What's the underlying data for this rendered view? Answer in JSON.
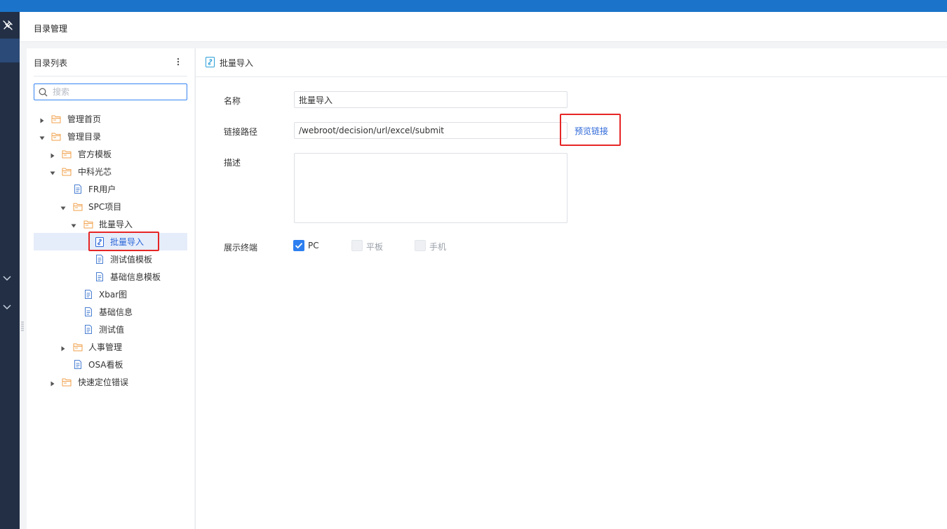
{
  "header": {
    "title": "目录管理"
  },
  "icons": {
    "pin": "pin-icon",
    "collapse": "chevron-down-icon",
    "more": "more-vertical-icon",
    "search": "search-icon",
    "folder": "folder-icon",
    "file": "file-icon",
    "link": "link-icon",
    "check": "check-icon"
  },
  "colors": {
    "topbar": "#1b74c9",
    "sidebar": "#222f45",
    "accent": "#2c67d8",
    "folder": "#f0a04b",
    "highlight_box": "#e62525"
  },
  "tree_panel": {
    "title": "目录列表",
    "search_placeholder": "搜索",
    "items": [
      {
        "label": "管理首页",
        "type": "folder",
        "state": "collapsed"
      },
      {
        "label": "管理目录",
        "type": "folder",
        "state": "expanded"
      },
      {
        "label": "官方模板",
        "type": "folder",
        "state": "collapsed"
      },
      {
        "label": "中科光芯",
        "type": "folder",
        "state": "expanded"
      },
      {
        "label": "FR用户",
        "type": "file"
      },
      {
        "label": "SPC项目",
        "type": "folder",
        "state": "expanded"
      },
      {
        "label": "批量导入",
        "type": "folder",
        "state": "expanded"
      },
      {
        "label": "批量导入",
        "type": "link",
        "selected": true
      },
      {
        "label": "测试值模板",
        "type": "file"
      },
      {
        "label": "基础信息模板",
        "type": "file"
      },
      {
        "label": "Xbar图",
        "type": "file"
      },
      {
        "label": "基础信息",
        "type": "file"
      },
      {
        "label": "测试值",
        "type": "file"
      },
      {
        "label": "人事管理",
        "type": "folder",
        "state": "collapsed"
      },
      {
        "label": "OSA看板",
        "type": "file"
      },
      {
        "label": "快速定位错误",
        "type": "folder",
        "state": "collapsed"
      }
    ]
  },
  "detail": {
    "title": "批量导入",
    "form": {
      "name_label": "名称",
      "name_value": "批量导入",
      "path_label": "链接路径",
      "path_value": "/webroot/decision/url/excel/submit",
      "preview_link": "预览链接",
      "desc_label": "描述",
      "desc_value": "",
      "terminal_label": "展示终端",
      "terminals": [
        {
          "label": "PC",
          "checked": true
        },
        {
          "label": "平板",
          "checked": false
        },
        {
          "label": "手机",
          "checked": false
        }
      ]
    }
  }
}
